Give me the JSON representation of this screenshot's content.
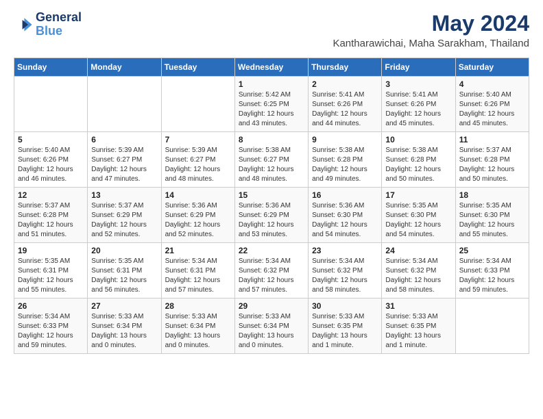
{
  "logo": {
    "line1": "General",
    "line2": "Blue"
  },
  "title": "May 2024",
  "subtitle": "Kantharawichai, Maha Sarakham, Thailand",
  "weekdays": [
    "Sunday",
    "Monday",
    "Tuesday",
    "Wednesday",
    "Thursday",
    "Friday",
    "Saturday"
  ],
  "weeks": [
    [
      {
        "day": "",
        "info": ""
      },
      {
        "day": "",
        "info": ""
      },
      {
        "day": "",
        "info": ""
      },
      {
        "day": "1",
        "info": "Sunrise: 5:42 AM\nSunset: 6:25 PM\nDaylight: 12 hours\nand 43 minutes."
      },
      {
        "day": "2",
        "info": "Sunrise: 5:41 AM\nSunset: 6:26 PM\nDaylight: 12 hours\nand 44 minutes."
      },
      {
        "day": "3",
        "info": "Sunrise: 5:41 AM\nSunset: 6:26 PM\nDaylight: 12 hours\nand 45 minutes."
      },
      {
        "day": "4",
        "info": "Sunrise: 5:40 AM\nSunset: 6:26 PM\nDaylight: 12 hours\nand 45 minutes."
      }
    ],
    [
      {
        "day": "5",
        "info": "Sunrise: 5:40 AM\nSunset: 6:26 PM\nDaylight: 12 hours\nand 46 minutes."
      },
      {
        "day": "6",
        "info": "Sunrise: 5:39 AM\nSunset: 6:27 PM\nDaylight: 12 hours\nand 47 minutes."
      },
      {
        "day": "7",
        "info": "Sunrise: 5:39 AM\nSunset: 6:27 PM\nDaylight: 12 hours\nand 48 minutes."
      },
      {
        "day": "8",
        "info": "Sunrise: 5:38 AM\nSunset: 6:27 PM\nDaylight: 12 hours\nand 48 minutes."
      },
      {
        "day": "9",
        "info": "Sunrise: 5:38 AM\nSunset: 6:28 PM\nDaylight: 12 hours\nand 49 minutes."
      },
      {
        "day": "10",
        "info": "Sunrise: 5:38 AM\nSunset: 6:28 PM\nDaylight: 12 hours\nand 50 minutes."
      },
      {
        "day": "11",
        "info": "Sunrise: 5:37 AM\nSunset: 6:28 PM\nDaylight: 12 hours\nand 50 minutes."
      }
    ],
    [
      {
        "day": "12",
        "info": "Sunrise: 5:37 AM\nSunset: 6:28 PM\nDaylight: 12 hours\nand 51 minutes."
      },
      {
        "day": "13",
        "info": "Sunrise: 5:37 AM\nSunset: 6:29 PM\nDaylight: 12 hours\nand 52 minutes."
      },
      {
        "day": "14",
        "info": "Sunrise: 5:36 AM\nSunset: 6:29 PM\nDaylight: 12 hours\nand 52 minutes."
      },
      {
        "day": "15",
        "info": "Sunrise: 5:36 AM\nSunset: 6:29 PM\nDaylight: 12 hours\nand 53 minutes."
      },
      {
        "day": "16",
        "info": "Sunrise: 5:36 AM\nSunset: 6:30 PM\nDaylight: 12 hours\nand 54 minutes."
      },
      {
        "day": "17",
        "info": "Sunrise: 5:35 AM\nSunset: 6:30 PM\nDaylight: 12 hours\nand 54 minutes."
      },
      {
        "day": "18",
        "info": "Sunrise: 5:35 AM\nSunset: 6:30 PM\nDaylight: 12 hours\nand 55 minutes."
      }
    ],
    [
      {
        "day": "19",
        "info": "Sunrise: 5:35 AM\nSunset: 6:31 PM\nDaylight: 12 hours\nand 55 minutes."
      },
      {
        "day": "20",
        "info": "Sunrise: 5:35 AM\nSunset: 6:31 PM\nDaylight: 12 hours\nand 56 minutes."
      },
      {
        "day": "21",
        "info": "Sunrise: 5:34 AM\nSunset: 6:31 PM\nDaylight: 12 hours\nand 57 minutes."
      },
      {
        "day": "22",
        "info": "Sunrise: 5:34 AM\nSunset: 6:32 PM\nDaylight: 12 hours\nand 57 minutes."
      },
      {
        "day": "23",
        "info": "Sunrise: 5:34 AM\nSunset: 6:32 PM\nDaylight: 12 hours\nand 58 minutes."
      },
      {
        "day": "24",
        "info": "Sunrise: 5:34 AM\nSunset: 6:32 PM\nDaylight: 12 hours\nand 58 minutes."
      },
      {
        "day": "25",
        "info": "Sunrise: 5:34 AM\nSunset: 6:33 PM\nDaylight: 12 hours\nand 59 minutes."
      }
    ],
    [
      {
        "day": "26",
        "info": "Sunrise: 5:34 AM\nSunset: 6:33 PM\nDaylight: 12 hours\nand 59 minutes."
      },
      {
        "day": "27",
        "info": "Sunrise: 5:33 AM\nSunset: 6:34 PM\nDaylight: 13 hours\nand 0 minutes."
      },
      {
        "day": "28",
        "info": "Sunrise: 5:33 AM\nSunset: 6:34 PM\nDaylight: 13 hours\nand 0 minutes."
      },
      {
        "day": "29",
        "info": "Sunrise: 5:33 AM\nSunset: 6:34 PM\nDaylight: 13 hours\nand 0 minutes."
      },
      {
        "day": "30",
        "info": "Sunrise: 5:33 AM\nSunset: 6:35 PM\nDaylight: 13 hours\nand 1 minute."
      },
      {
        "day": "31",
        "info": "Sunrise: 5:33 AM\nSunset: 6:35 PM\nDaylight: 13 hours\nand 1 minute."
      },
      {
        "day": "",
        "info": ""
      }
    ]
  ]
}
